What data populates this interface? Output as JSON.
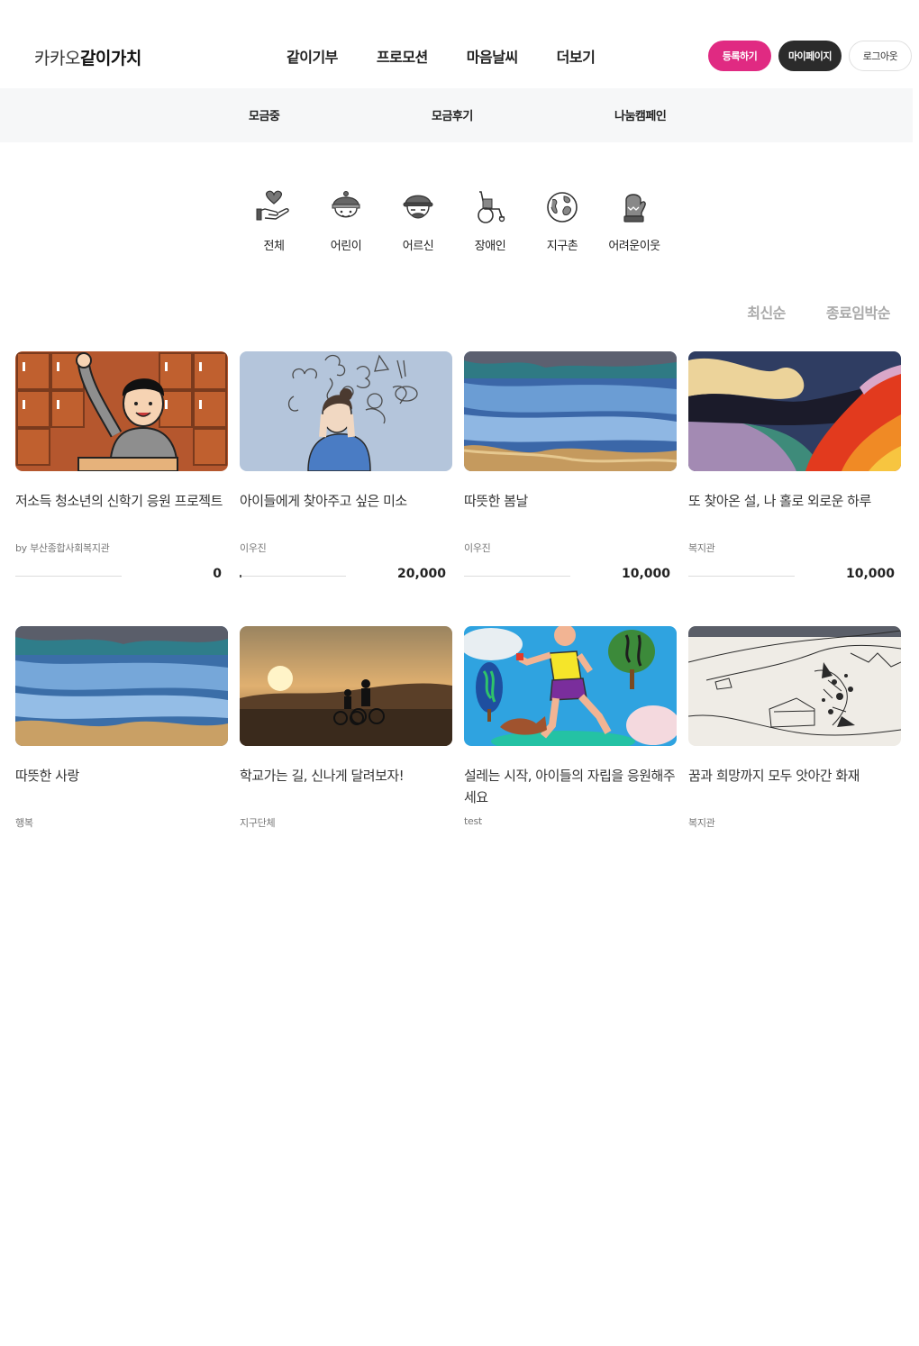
{
  "header": {
    "logo_light": "카카오",
    "logo_bold": "같이가치",
    "nav": [
      "같이기부",
      "프로모션",
      "마음날씨",
      "더보기"
    ],
    "register_label": "등록하기",
    "mypage_label": "마이페이지",
    "logout_label": "로그아웃"
  },
  "subnav": [
    "모금중",
    "모금후기",
    "나눔캠페인"
  ],
  "categories": [
    {
      "label": "전체",
      "icon": "hand-heart-icon"
    },
    {
      "label": "어린이",
      "icon": "child-face-icon"
    },
    {
      "label": "어르신",
      "icon": "elder-face-icon"
    },
    {
      "label": "장애인",
      "icon": "wheelchair-icon"
    },
    {
      "label": "지구촌",
      "icon": "globe-icon"
    },
    {
      "label": "어려운이웃",
      "icon": "mitten-icon"
    }
  ],
  "sort": [
    "최신순",
    "종료임박순"
  ],
  "cards": [
    {
      "title": "저소득 청소년의 신학기 응원 프로젝트",
      "org": "by 부산종합사회복지관",
      "amount": "0",
      "progress": 0
    },
    {
      "title": "아이들에게 찾아주고 싶은 미소",
      "org": "이우진",
      "amount": "20,000",
      "progress": 0.01
    },
    {
      "title": "따뜻한 봄날",
      "org": "이우진",
      "amount": "10,000",
      "progress": 0
    },
    {
      "title": "또 찾아온 설, 나 홀로 외로운 하루",
      "org": "복지관",
      "amount": "10,000",
      "progress": 0
    },
    {
      "title": "따뜻한 사랑",
      "org": "행복"
    },
    {
      "title": "학교가는 길, 신나게 달려보자!",
      "org": "지구단체"
    },
    {
      "title": "설레는 시작, 아이들의 자립을 응원해주세요",
      "org": "test"
    },
    {
      "title": "꿈과 희망까지 모두 앗아간 화재",
      "org": "복지관"
    }
  ]
}
